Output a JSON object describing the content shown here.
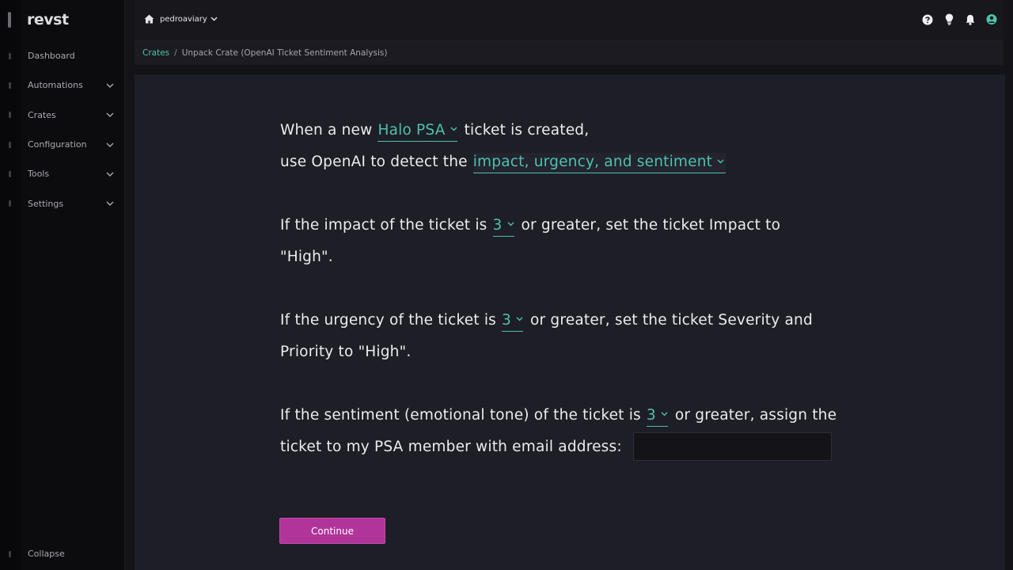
{
  "app": {
    "logo_text": "revst"
  },
  "sidebar": {
    "items": [
      {
        "label": "Dashboard",
        "has_children": false
      },
      {
        "label": "Automations",
        "has_children": true
      },
      {
        "label": "Crates",
        "has_children": true
      },
      {
        "label": "Configuration",
        "has_children": true
      },
      {
        "label": "Tools",
        "has_children": true
      },
      {
        "label": "Settings",
        "has_children": true
      }
    ],
    "collapse_label": "Collapse"
  },
  "topbar": {
    "org_name": "pedroaviary",
    "icons": [
      "help-icon",
      "lightbulb-icon",
      "bell-icon",
      "user-icon"
    ]
  },
  "breadcrumb": {
    "link": "Crates",
    "separator": "/",
    "current": "Unpack Crate (OpenAI Ticket Sentiment Analysis)"
  },
  "form": {
    "l1_pre": "When a new",
    "psa_select": "Halo PSA",
    "l1_post": "ticket is created,",
    "l2_pre": "use OpenAI to detect the",
    "detect_select": "impact, urgency, and sentiment",
    "impact_pre": "If the impact of the ticket is",
    "impact_select": "3",
    "impact_post": "or greater, set the ticket Impact to",
    "impact_end": "\"High\".",
    "urgency_pre": "If the urgency of the ticket is",
    "urgency_select": "3",
    "urgency_post": "or greater, set the ticket Severity and",
    "urgency_end": "Priority to \"High\".",
    "sentiment_pre": "If the sentiment (emotional tone) of the ticket is",
    "sentiment_select": "3",
    "sentiment_post": "or greater, assign the",
    "sentiment_end": "ticket to my PSA member with email address:",
    "email_value": ""
  },
  "actions": {
    "continue_label": "Continue"
  },
  "colors": {
    "accent": "#4ec2b0",
    "button": "#b0349a",
    "panel": "#1d1e26",
    "sidebar": "#0c0c0f"
  }
}
